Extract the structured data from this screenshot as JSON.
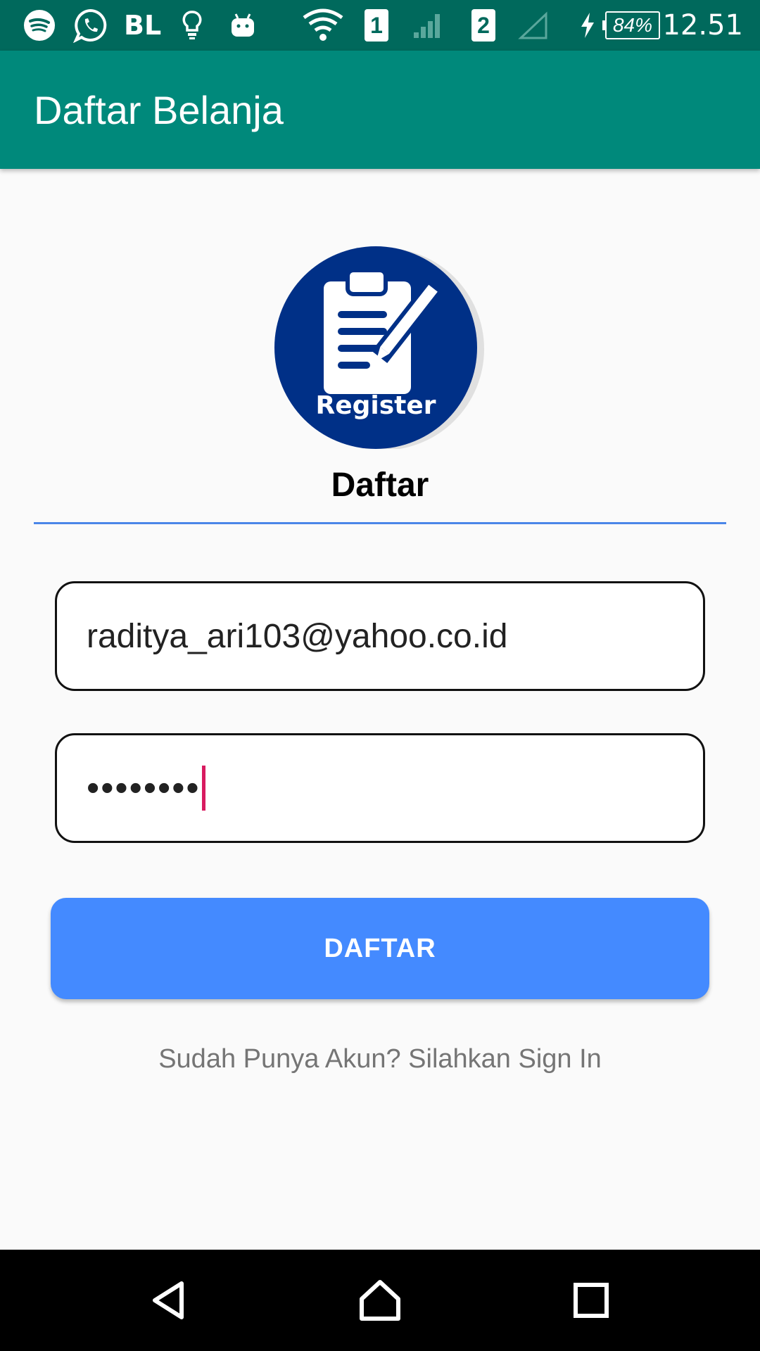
{
  "status_bar": {
    "icons": [
      "spotify-icon",
      "whatsapp-icon",
      "lightbulb-icon",
      "android-icon",
      "wifi-icon",
      "sim1-icon",
      "signal-icon",
      "sim2-icon",
      "signal-empty-icon",
      "charging-icon"
    ],
    "carrier_label": "BL",
    "sim1_label": "1",
    "sim2_label": "2",
    "battery": "84%",
    "time": "12.51"
  },
  "app_bar": {
    "title": "Daftar Belanja"
  },
  "logo": {
    "label": "Register",
    "bg_color": "#003087"
  },
  "form": {
    "heading": "Daftar",
    "email_value": "raditya_ari103@yahoo.co.id",
    "password_value": "••••••••",
    "submit_label": "DAFTAR",
    "signin_link": "Sudah Punya Akun? Silahkan Sign In"
  },
  "nav_bar": {
    "icons": [
      "back-icon",
      "home-icon",
      "recents-icon"
    ]
  },
  "colors": {
    "status_bar": "#00695c",
    "app_bar": "#00897b",
    "button": "#448aff",
    "accent_line": "#4a86e8",
    "cursor": "#d81b60"
  }
}
